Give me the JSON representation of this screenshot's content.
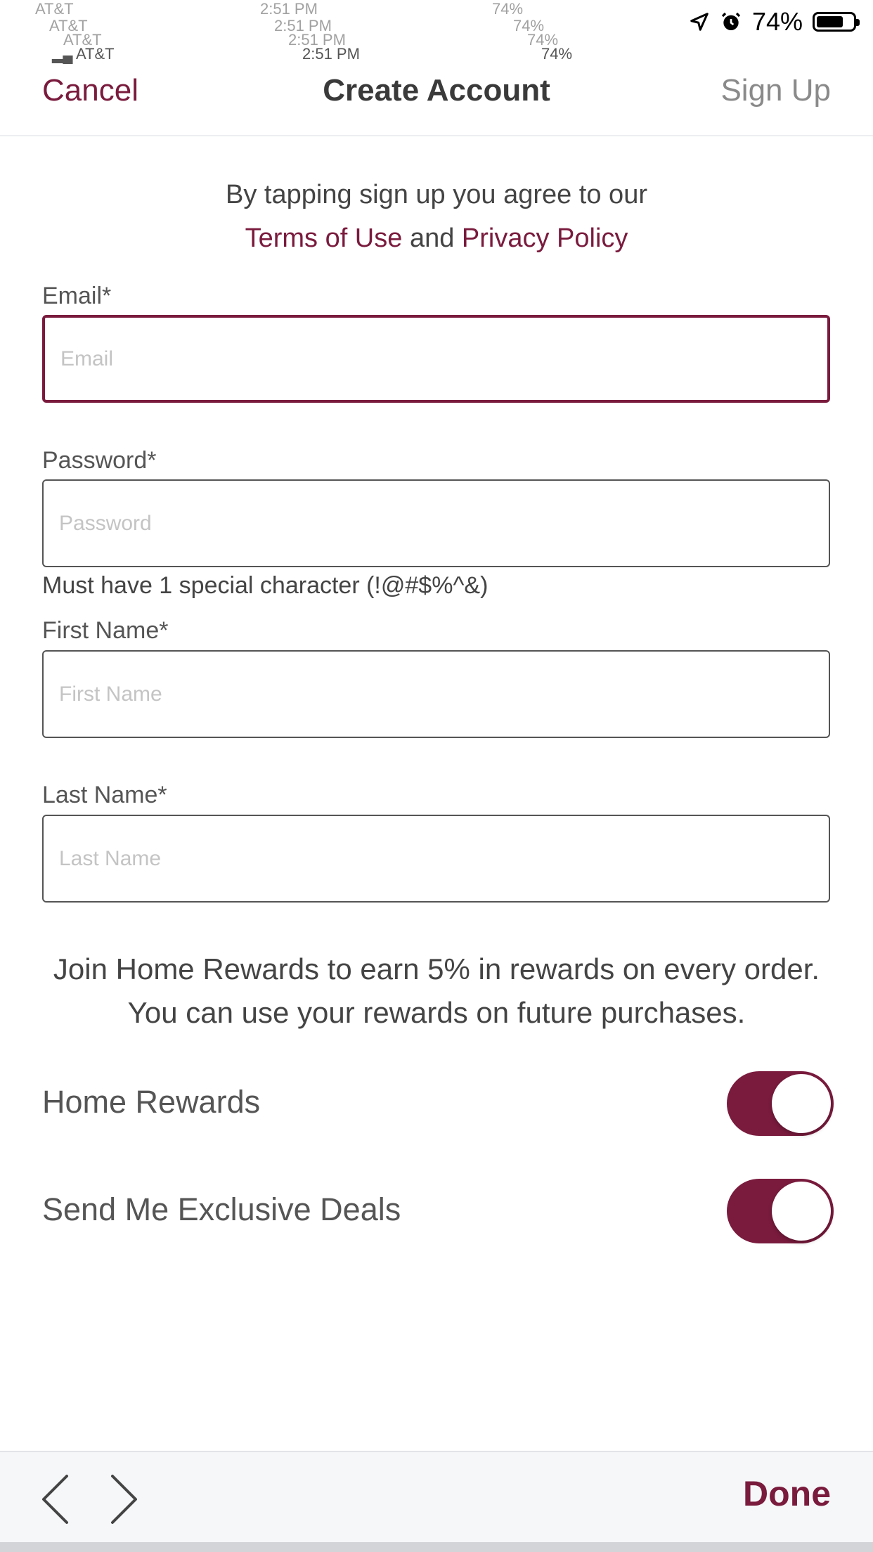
{
  "status_bar": {
    "carrier": "AT&T",
    "time": "2:51 PM",
    "battery": "74%",
    "battery_level": 0.74,
    "icons": [
      "location-arrow-icon",
      "alarm-icon",
      "battery-icon"
    ]
  },
  "nav": {
    "cancel": "Cancel",
    "title": "Create Account",
    "sign_up": "Sign Up"
  },
  "agree": {
    "text": "By tapping sign up you agree to our",
    "terms": "Terms of Use",
    "and": "and",
    "privacy": "Privacy Policy"
  },
  "form": {
    "email": {
      "label": "Email*",
      "placeholder": "Email",
      "value": ""
    },
    "password": {
      "label": "Password*",
      "placeholder": "Password",
      "value": ""
    },
    "password_hint": "Must have 1 special character (!@#$%^&)",
    "first_name": {
      "label": "First Name*",
      "placeholder": "First Name",
      "value": ""
    },
    "last_name": {
      "label": "Last Name*",
      "placeholder": "Last Name",
      "value": ""
    }
  },
  "rewards": {
    "text": "Join Home Rewards to earn 5% in rewards on every order. You can use your rewards on future purchases."
  },
  "toggles": [
    {
      "label": "Home Rewards",
      "on": true
    },
    {
      "label": "Send Me Exclusive Deals",
      "on": true
    }
  ],
  "accessory": {
    "done": "Done",
    "icons": [
      "chevron-left-icon",
      "chevron-right-icon"
    ]
  },
  "colors": {
    "accent": "#7a1b3d",
    "text": "#444444",
    "muted": "#8a8a8a"
  }
}
